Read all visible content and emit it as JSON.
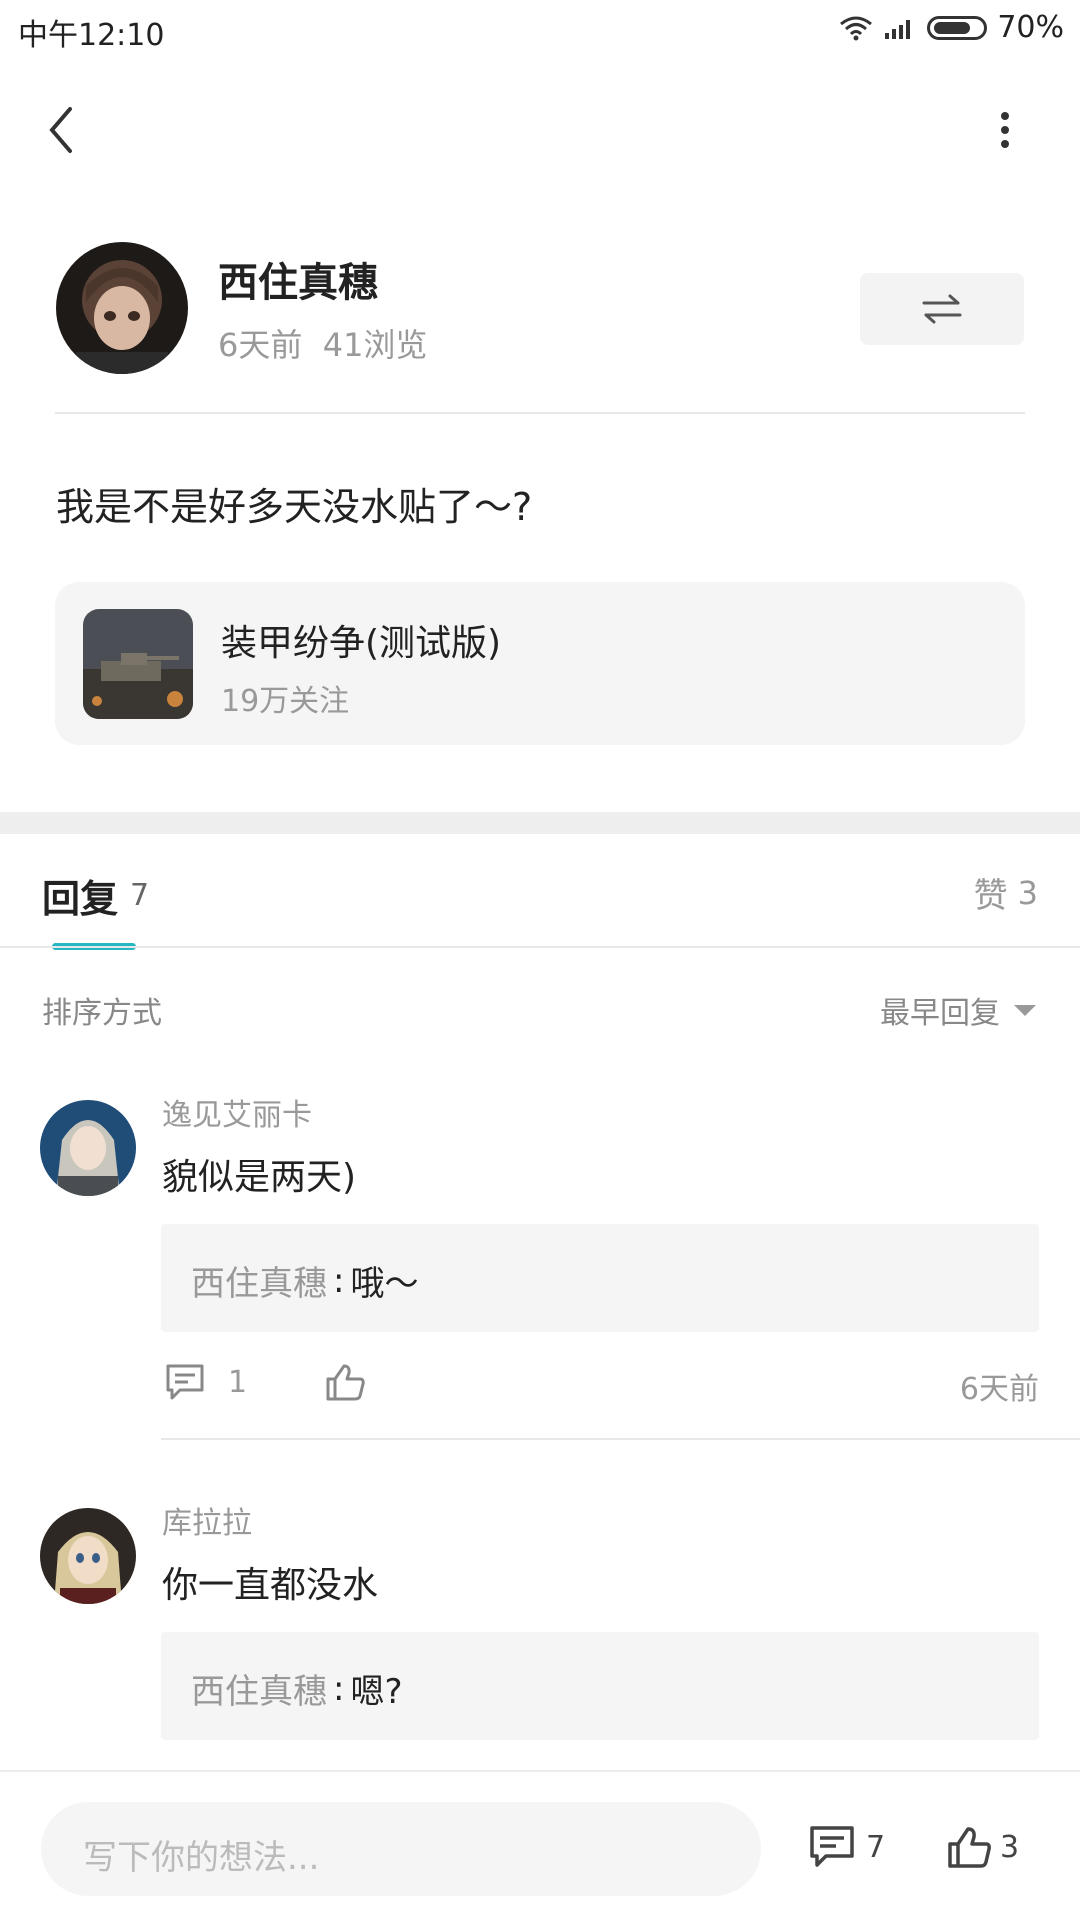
{
  "status_bar": {
    "time": "中午12:10",
    "battery": "70%"
  },
  "post": {
    "author": "西住真穗",
    "meta": "6天前  41浏览",
    "content": "我是不是好多天没水贴了～?",
    "community": {
      "name": "装甲纷争(测试版)",
      "followers": "19万关注"
    }
  },
  "tabs": {
    "replies_label": "回复",
    "replies_count": "7",
    "likes_label": "赞",
    "likes_count": "3"
  },
  "sort": {
    "label": "排序方式",
    "value": "最早回复"
  },
  "comments": [
    {
      "user": "逸见艾丽卡",
      "text": "貌似是两天)",
      "quote_user": "西住真穗",
      "quote_text": "哦～",
      "reply_count": "1",
      "time": "6天前"
    },
    {
      "user": "库拉拉",
      "text": "你一直都没水",
      "quote_user": "西住真穗",
      "quote_text": "嗯?"
    }
  ],
  "bottom_bar": {
    "placeholder": "写下你的想法...",
    "comment_count": "7",
    "like_count": "3"
  },
  "colors": {
    "accent": "#25b7c4"
  }
}
